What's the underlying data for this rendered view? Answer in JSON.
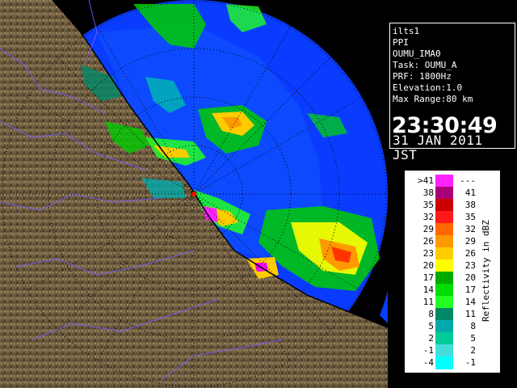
{
  "info": {
    "station": "ilts1",
    "product": "PPI",
    "site": "OUMU_IMA0",
    "task": "Task: OUMU_A",
    "prf": "PRF: 1800Hz",
    "elevation": "Elevation:1.0",
    "max_range": "Max Range:80 km",
    "time": "23:30:49",
    "date": "31 JAN 2011 JST"
  },
  "legend": {
    "title": "Reflectivity in dBZ",
    "rows": [
      {
        "lo": ">41",
        "hi": "---",
        "color": "#ff22ff"
      },
      {
        "lo": "38",
        "hi": "41",
        "color": "#aa0077"
      },
      {
        "lo": "35",
        "hi": "38",
        "color": "#cc0000"
      },
      {
        "lo": "32",
        "hi": "35",
        "color": "#ff1a1a"
      },
      {
        "lo": "29",
        "hi": "32",
        "color": "#ff6600"
      },
      {
        "lo": "26",
        "hi": "29",
        "color": "#ff9900"
      },
      {
        "lo": "23",
        "hi": "26",
        "color": "#ffcc00"
      },
      {
        "lo": "20",
        "hi": "23",
        "color": "#ffff00"
      },
      {
        "lo": "17",
        "hi": "20",
        "color": "#00aa00"
      },
      {
        "lo": "14",
        "hi": "17",
        "color": "#00dd00"
      },
      {
        "lo": "11",
        "hi": "14",
        "color": "#22ff22"
      },
      {
        "lo": "8",
        "hi": "11",
        "color": "#008866"
      },
      {
        "lo": "5",
        "hi": "8",
        "color": "#00aaaa"
      },
      {
        "lo": "2",
        "hi": "5",
        "color": "#00cc99"
      },
      {
        "lo": "-1",
        "hi": "2",
        "color": "#44dddd"
      },
      {
        "lo": "-4",
        "hi": "-1",
        "color": "#00ffff"
      }
    ]
  },
  "map": {
    "radar_disc_color": "#0a3cff",
    "terrain_color": "#6b5a3e",
    "range_ring_color": "#000000"
  }
}
